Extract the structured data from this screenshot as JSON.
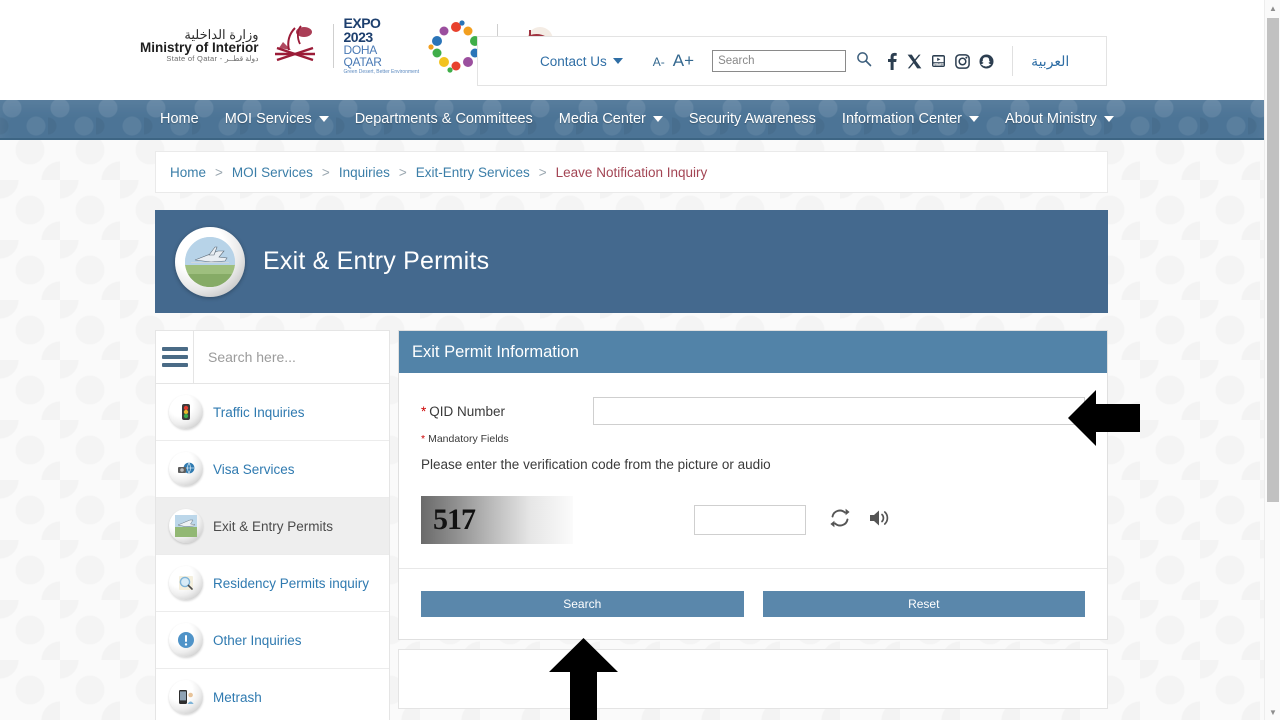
{
  "header": {
    "ministry": {
      "arabic": "وزارة الداخلية",
      "english": "Ministry of Interior",
      "sub": "State of Qatar - دولة قطــر"
    },
    "expo": {
      "line1": "EXPO",
      "line2": "2023",
      "line3": "DOHA",
      "line4": "QATAR",
      "tagline": "Green Desert, Better Environment"
    },
    "tools": {
      "contact_us": "Contact Us",
      "font_decrease": "A-",
      "font_increase": "A+",
      "search_placeholder": "Search",
      "search_value": "",
      "arabic_link": "العربية",
      "socials": [
        "facebook-icon",
        "x-twitter-icon",
        "youtube-icon",
        "instagram-icon",
        "snapchat-icon"
      ]
    }
  },
  "nav": {
    "items": [
      {
        "label": "Home",
        "caret": false
      },
      {
        "label": "MOI Services",
        "caret": true
      },
      {
        "label": "Departments & Committees",
        "caret": false
      },
      {
        "label": "Media Center",
        "caret": true
      },
      {
        "label": "Security Awareness",
        "caret": false
      },
      {
        "label": "Information Center",
        "caret": true
      },
      {
        "label": "About Ministry",
        "caret": true
      }
    ]
  },
  "breadcrumb": {
    "items": [
      "Home",
      "MOI Services",
      "Inquiries",
      "Exit-Entry Services"
    ],
    "separator": ">",
    "current": "Leave Notification Inquiry"
  },
  "banner": {
    "title": "Exit & Entry Permits",
    "icon": "airplane-icon"
  },
  "sidebar": {
    "search_placeholder": "Search here...",
    "search_value": "",
    "items": [
      {
        "label": "Traffic Inquiries",
        "icon": "traffic-light-icon",
        "glyph": "🚦",
        "active": false
      },
      {
        "label": "Visa Services",
        "icon": "visa-globe-icon",
        "glyph": "🌐",
        "active": false
      },
      {
        "label": "Exit & Entry Permits",
        "icon": "airplane-icon",
        "glyph": "✈",
        "active": true
      },
      {
        "label": "Residency Permits inquiry",
        "icon": "magnifier-document-icon",
        "glyph": "🔍",
        "active": false
      },
      {
        "label": "Other Inquiries",
        "icon": "exclamation-icon",
        "glyph": "❗",
        "active": false
      },
      {
        "label": "Metrash",
        "icon": "mobile-phone-icon",
        "glyph": "📱",
        "active": false
      }
    ]
  },
  "form": {
    "title": "Exit Permit Information",
    "qid_label": "QID Number",
    "qid_value": "",
    "required_marker": "*",
    "mandatory_note": "Mandatory Fields",
    "verification_text": "Please enter the verification code from the picture or audio",
    "captcha_code": "517",
    "captcha_value": "",
    "refresh_icon": "refresh-icon",
    "audio_icon": "speaker-icon",
    "search_button": "Search",
    "reset_button": "Reset"
  },
  "annotations": {
    "arrow_left": "left-pointing-arrow",
    "arrow_up": "up-pointing-arrow"
  },
  "colors": {
    "nav_bg": "#4c7496",
    "banner_bg": "#44698e",
    "form_head_bg": "#5283a8",
    "button_bg": "#5a87ab",
    "link": "#2f7ab0",
    "breadcrumb_current": "#a34554",
    "required": "#cc0000"
  }
}
